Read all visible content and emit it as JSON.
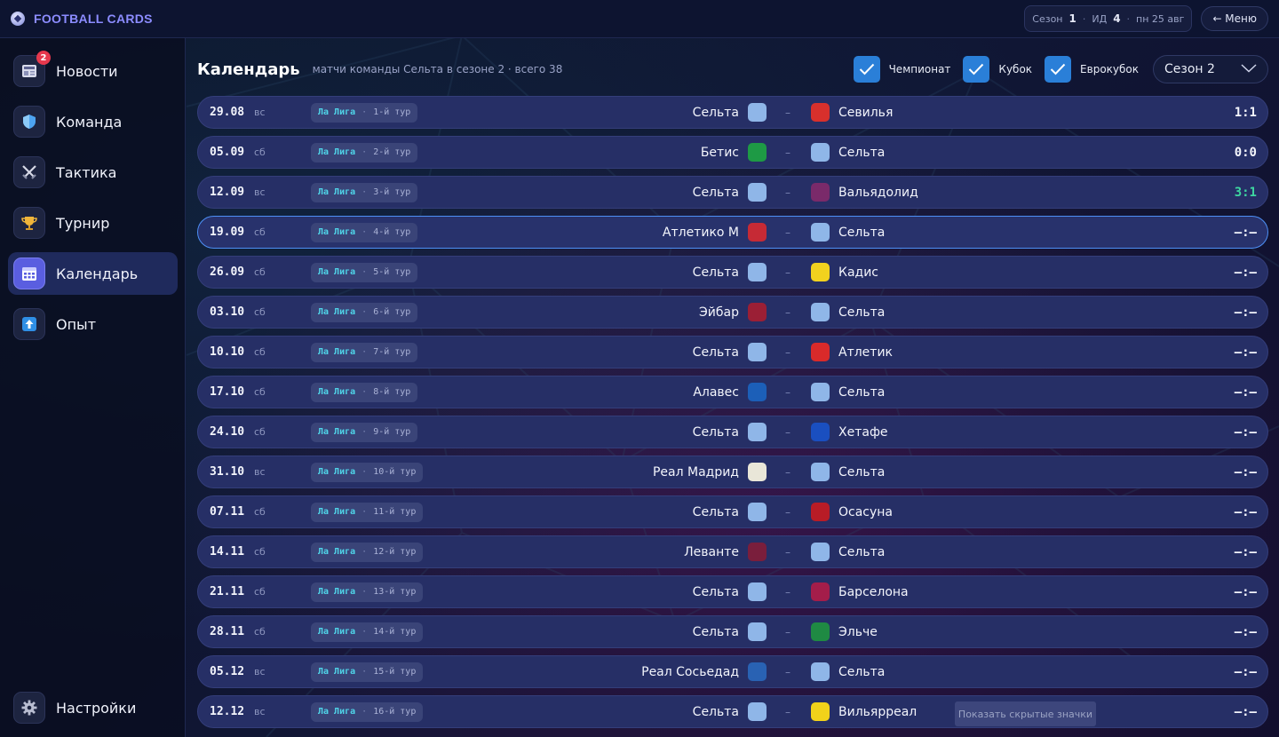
{
  "app": {
    "brand": "FOOTBALL CARDS"
  },
  "topbar": {
    "season_label": "Сезон",
    "season_value": "1",
    "id_label": "ИД",
    "id_value": "4",
    "date": "пн 25 авг",
    "menu_label": "← Меню"
  },
  "sidebar": {
    "items": [
      {
        "label": "Новости",
        "icon": "newspaper-icon",
        "badge": "2"
      },
      {
        "label": "Команда",
        "icon": "shield-icon"
      },
      {
        "label": "Тактика",
        "icon": "crossed-swords-icon"
      },
      {
        "label": "Турнир",
        "icon": "trophy-icon"
      },
      {
        "label": "Календарь",
        "icon": "calendar-icon",
        "active": true
      },
      {
        "label": "Опыт",
        "icon": "arrow-up-icon"
      }
    ],
    "settings": {
      "label": "Настройки",
      "icon": "gear-icon"
    }
  },
  "main": {
    "title": "Календарь",
    "subtitle": "матчи команды Сельта в сезоне 2 · всего 38",
    "filters": [
      {
        "label": "Чемпионат",
        "checked": true
      },
      {
        "label": "Кубок",
        "checked": true
      },
      {
        "label": "Еврокубок",
        "checked": true
      }
    ],
    "season_select": "Сезон 2"
  },
  "colors": {
    "accent": "#5a5ee0",
    "row_bg": "#262f66",
    "league": "#4fd4e8",
    "win": "#3ed6a0",
    "checkbox": "#2a7fd8"
  },
  "matches": [
    {
      "date": "29.08",
      "dow": "вс",
      "league": "Ла Лига",
      "round": "1-й тур",
      "home": "Сельта",
      "away": "Севилья",
      "score": "1:1",
      "result": "draw"
    },
    {
      "date": "05.09",
      "dow": "сб",
      "league": "Ла Лига",
      "round": "2-й тур",
      "home": "Бетис",
      "away": "Сельта",
      "score": "0:0",
      "result": "draw"
    },
    {
      "date": "12.09",
      "dow": "вс",
      "league": "Ла Лига",
      "round": "3-й тур",
      "home": "Сельта",
      "away": "Вальядолид",
      "score": "3:1",
      "result": "win"
    },
    {
      "date": "19.09",
      "dow": "сб",
      "league": "Ла Лига",
      "round": "4-й тур",
      "home": "Атлетико М",
      "away": "Сельта",
      "score": "–:–",
      "result": "next"
    },
    {
      "date": "26.09",
      "dow": "сб",
      "league": "Ла Лига",
      "round": "5-й тур",
      "home": "Сельта",
      "away": "Кадис",
      "score": "–:–"
    },
    {
      "date": "03.10",
      "dow": "сб",
      "league": "Ла Лига",
      "round": "6-й тур",
      "home": "Эйбар",
      "away": "Сельта",
      "score": "–:–"
    },
    {
      "date": "10.10",
      "dow": "сб",
      "league": "Ла Лига",
      "round": "7-й тур",
      "home": "Сельта",
      "away": "Атлетик",
      "score": "–:–"
    },
    {
      "date": "17.10",
      "dow": "сб",
      "league": "Ла Лига",
      "round": "8-й тур",
      "home": "Алавес",
      "away": "Сельта",
      "score": "–:–"
    },
    {
      "date": "24.10",
      "dow": "сб",
      "league": "Ла Лига",
      "round": "9-й тур",
      "home": "Сельта",
      "away": "Хетафе",
      "score": "–:–"
    },
    {
      "date": "31.10",
      "dow": "вс",
      "league": "Ла Лига",
      "round": "10-й тур",
      "home": "Реал Мадрид",
      "away": "Сельта",
      "score": "–:–"
    },
    {
      "date": "07.11",
      "dow": "сб",
      "league": "Ла Лига",
      "round": "11-й тур",
      "home": "Сельта",
      "away": "Осасуна",
      "score": "–:–"
    },
    {
      "date": "14.11",
      "dow": "сб",
      "league": "Ла Лига",
      "round": "12-й тур",
      "home": "Леванте",
      "away": "Сельта",
      "score": "–:–"
    },
    {
      "date": "21.11",
      "dow": "сб",
      "league": "Ла Лига",
      "round": "13-й тур",
      "home": "Сельта",
      "away": "Барселона",
      "score": "–:–"
    },
    {
      "date": "28.11",
      "dow": "сб",
      "league": "Ла Лига",
      "round": "14-й тур",
      "home": "Сельта",
      "away": "Эльче",
      "score": "–:–"
    },
    {
      "date": "05.12",
      "dow": "вс",
      "league": "Ла Лига",
      "round": "15-й тур",
      "home": "Реал Сосьедад",
      "away": "Сельта",
      "score": "–:–"
    },
    {
      "date": "12.12",
      "dow": "вс",
      "league": "Ла Лига",
      "round": "16-й тур",
      "home": "Сельта",
      "away": "Вильярреал",
      "score": "–:–"
    }
  ],
  "crests": {
    "Сельта": "#8fb6e8",
    "Севилья": "#d8302c",
    "Бетис": "#1e9a45",
    "Вальядолид": "#7a2a6a",
    "Атлетико М": "#c62a35",
    "Кадис": "#f2d21e",
    "Эйбар": "#9b1f35",
    "Атлетик": "#d92a2a",
    "Алавес": "#1c5fb8",
    "Хетафе": "#1a4fc0",
    "Реал Мадрид": "#e9e6d8",
    "Осасуна": "#b81c26",
    "Леванте": "#7a1e3c",
    "Барселона": "#a41d4a",
    "Эльче": "#1f8a43",
    "Реал Сосьедад": "#2962b3",
    "Вильярреал": "#f1d21a"
  },
  "toast": "Показать скрытые значки"
}
